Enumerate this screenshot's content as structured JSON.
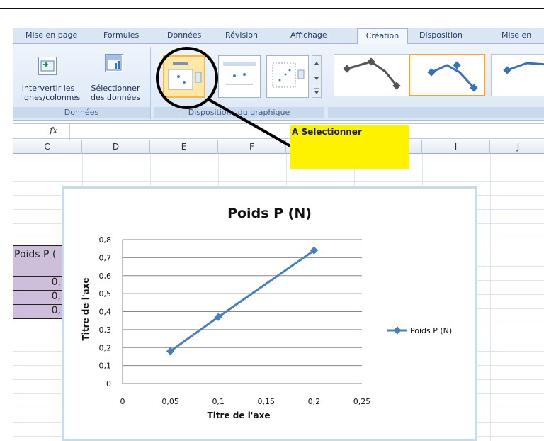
{
  "ribbon": {
    "tabs": [
      {
        "label": "Mise en page"
      },
      {
        "label": "Formules"
      },
      {
        "label": "Données"
      },
      {
        "label": "Révision"
      },
      {
        "label": "Affichage"
      },
      {
        "label": "Création"
      },
      {
        "label": "Disposition"
      },
      {
        "label": "Mise en"
      }
    ],
    "active_tab": "Création",
    "groups": {
      "donnees": {
        "label": "Données",
        "switch_button": "Intervertir les\nlignes/colonnes",
        "select_button": "Sélectionner\ndes données"
      },
      "layouts": {
        "label": "Dispositions du graphique"
      }
    }
  },
  "formula_bar": {
    "fx_label": "fx",
    "value": ""
  },
  "columns": [
    "C",
    "D",
    "E",
    "F",
    "G",
    "H",
    "I",
    "J"
  ],
  "cells": {
    "header": "Poids P (",
    "values": [
      "0,",
      "0,",
      "0,"
    ]
  },
  "annotation": {
    "text": "A Selectionner"
  },
  "chart_data": {
    "type": "line",
    "title": "Poids P (N)",
    "xlabel": "Titre de l'axe",
    "ylabel": "Titre de l'axe",
    "xlim": [
      0,
      0.25
    ],
    "ylim": [
      0,
      0.8
    ],
    "x_ticks": [
      "0",
      "0,05",
      "0,1",
      "0,15",
      "0,2",
      "0,25"
    ],
    "y_ticks": [
      "0",
      "0,1",
      "0,2",
      "0,3",
      "0,4",
      "0,5",
      "0,6",
      "0,7",
      "0,8"
    ],
    "series": [
      {
        "name": "Poids P (N)",
        "x": [
          0.05,
          0.1,
          0.2
        ],
        "values": [
          0.18,
          0.37,
          0.74
        ]
      }
    ],
    "legend_position": "right",
    "grid": true,
    "colors": {
      "series": "#4a7ebb",
      "grid": "#868686"
    }
  }
}
